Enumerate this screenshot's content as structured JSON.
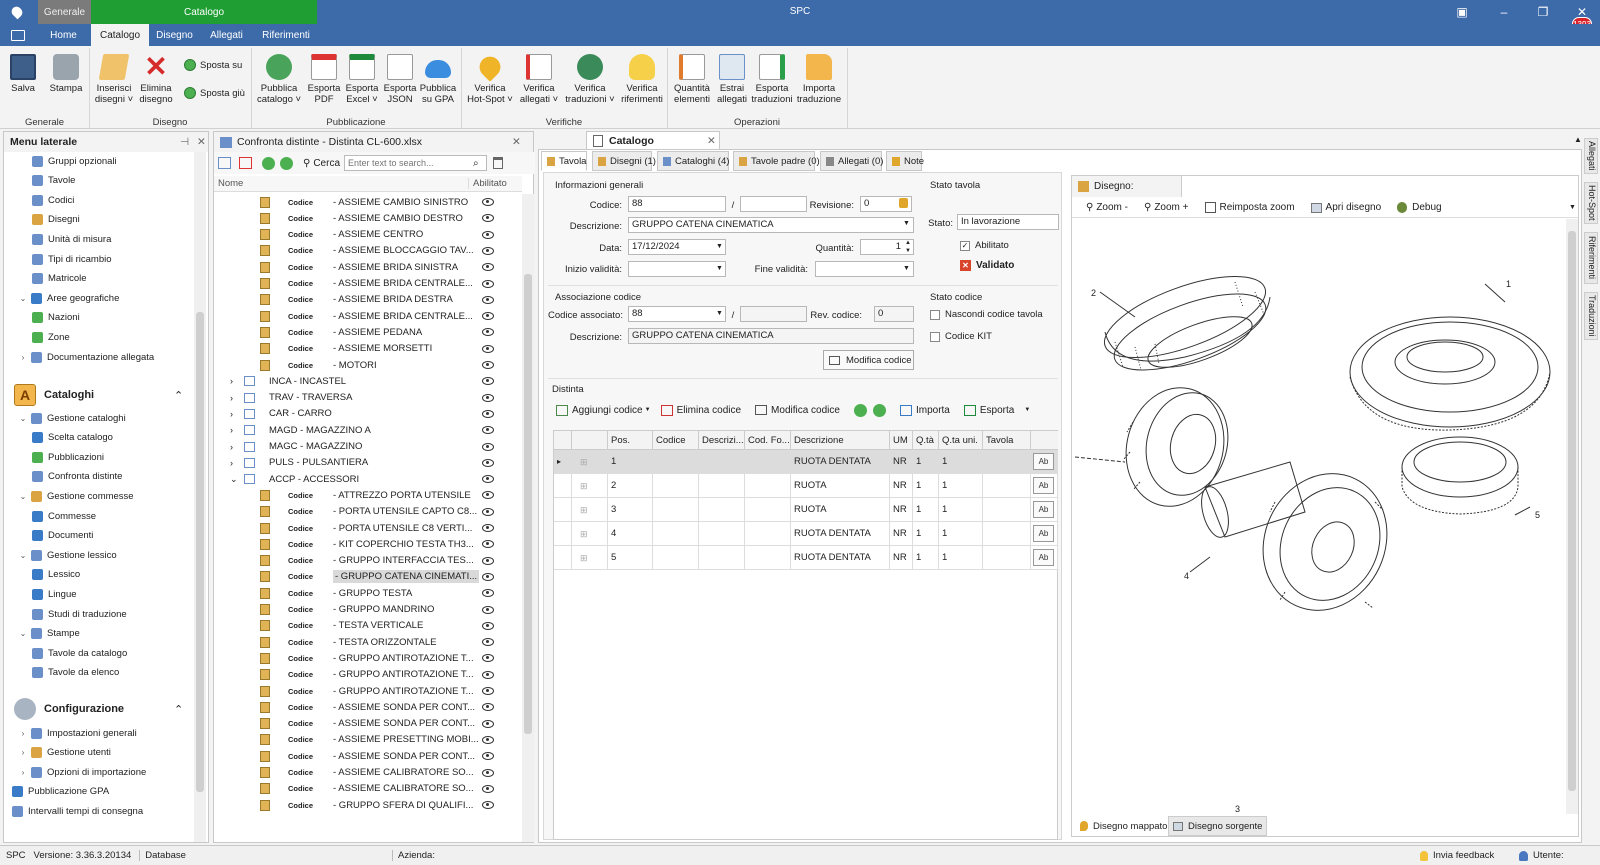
{
  "title_bar": {
    "app_title": "SPC",
    "context_general": "Generale",
    "context_catalog": "Catalogo",
    "notification_count": "1393"
  },
  "ribbon_tabs": [
    "Home",
    "Catalogo",
    "Disegno",
    "Allegati",
    "Riferimenti"
  ],
  "ribbon": {
    "buttons": {
      "salva": "Salva",
      "stampa": "Stampa",
      "inserisci": "Inserisci\ndisegni ˅",
      "elimina": "Elimina\ndisegno",
      "sposta_su": "Sposta su",
      "sposta_giu": "Sposta giù",
      "pubblica_catalogo": "Pubblica\ncatalogo ˅",
      "esporta_pdf": "Esporta\nPDF",
      "esporta_excel": "Esporta\nExcel ˅",
      "esporta_json": "Esporta\nJSON",
      "pubblica_gpa": "Pubblica\nsu GPA",
      "verifica_hotspot": "Verifica\nHot-Spot ˅",
      "verifica_allegati": "Verifica\nallegati ˅",
      "verifica_traduzioni": "Verifica\ntraduzioni ˅",
      "verifica_riferimenti": "Verifica\nriferimenti",
      "quantita_elementi": "Quantità\nelementi",
      "estrai_allegati": "Estrai\nallegati",
      "esporta_traduzioni": "Esporta\ntraduzioni",
      "importa_traduzione": "Importa\ntraduzione"
    },
    "groups": {
      "generale": "Generale",
      "disegno": "Disegno",
      "pubblicazione": "Pubblicazione",
      "verifiche": "Verifiche",
      "operazioni": "Operazioni"
    }
  },
  "left_panel": {
    "title": "Menu laterale",
    "items_top": [
      {
        "label": "Gruppi opzionali",
        "color": "#6b8fc9"
      },
      {
        "label": "Tavole",
        "color": "#6b8fc9"
      },
      {
        "label": "Codici",
        "color": "#6b8fc9"
      },
      {
        "label": "Disegni",
        "color": "#d9a441"
      },
      {
        "label": "Unità di misura",
        "color": "#6b8fc9"
      },
      {
        "label": "Tipi di ricambio",
        "color": "#6b8fc9"
      },
      {
        "label": "Matricole",
        "color": "#6b8fc9"
      },
      {
        "label": "Aree geografiche",
        "color": "#3a7bc8"
      },
      {
        "label": "Nazioni",
        "color": "#4caf50"
      },
      {
        "label": "Zone",
        "color": "#4caf50"
      },
      {
        "label": "Documentazione allegata",
        "color": "#6b8fc9"
      }
    ],
    "section_cataloghi": "Cataloghi",
    "items_cataloghi": [
      {
        "label": "Gestione cataloghi",
        "color": "#6b8fc9"
      },
      {
        "label": "Scelta catalogo",
        "color": "#3a7bc8"
      },
      {
        "label": "Pubblicazioni",
        "color": "#4caf50"
      },
      {
        "label": "Confronta distinte",
        "color": "#6b8fc9"
      },
      {
        "label": "Gestione commesse",
        "color": "#d9a441"
      },
      {
        "label": "Commesse",
        "color": "#3a7bc8"
      },
      {
        "label": "Documenti",
        "color": "#3a7bc8"
      },
      {
        "label": "Gestione lessico",
        "color": "#6b8fc9"
      },
      {
        "label": "Lessico",
        "color": "#3a7bc8"
      },
      {
        "label": "Lingue",
        "color": "#3a7bc8"
      },
      {
        "label": "Studi di traduzione",
        "color": "#6b8fc9"
      },
      {
        "label": "Stampe",
        "color": "#6b8fc9"
      },
      {
        "label": "Tavole da catalogo",
        "color": "#6b8fc9"
      },
      {
        "label": "Tavole da elenco",
        "color": "#6b8fc9"
      }
    ],
    "section_configurazione": "Configurazione",
    "items_config": [
      {
        "label": "Impostazioni generali",
        "color": "#6b8fc9"
      },
      {
        "label": "Gestione utenti",
        "color": "#d9a441"
      },
      {
        "label": "Opzioni di importazione",
        "color": "#6b8fc9"
      },
      {
        "label": "Pubblicazione GPA",
        "color": "#3a7bc8"
      },
      {
        "label": "Intervalli tempi di consegna",
        "color": "#6b8fc9"
      }
    ]
  },
  "middle_panel": {
    "title": "Confronta distinte - Distinta CL-600.xlsx",
    "search_label": "Cerca",
    "search_placeholder": "Enter text to search...",
    "col_name": "Nome",
    "col_enabled": "Abilitato",
    "codice_word": "Codice",
    "rows_a": [
      "- ASSIEME CAMBIO SINISTRO",
      "- ASSIEME CAMBIO DESTRO",
      "- ASSIEME CENTRO",
      "- ASSIEME BLOCCAGGIO TAV...",
      "- ASSIEME BRIDA SINISTRA",
      "- ASSIEME BRIDA CENTRALE...",
      "- ASSIEME BRIDA DESTRA",
      "- ASSIEME BRIDA CENTRALE...",
      "- ASSIEME PEDANA",
      "- ASSIEME MORSETTI",
      "- MOTORI"
    ],
    "groups": [
      "INCA - INCASTEL",
      "TRAV - TRAVERSA",
      "CAR - CARRO",
      "MAGD - MAGAZZINO A",
      "MAGC - MAGAZZINO",
      "PULS - PULSANTIERA",
      "ACCP - ACCESSORI"
    ],
    "rows_b": [
      "- ATTREZZO PORTA UTENSILE",
      "- PORTA UTENSILE CAPTO C8...",
      "- PORTA UTENSILE C8 VERTI...",
      "- KIT COPERCHIO TESTA TH3...",
      "- GRUPPO INTERFACCIA TES...",
      "- GRUPPO CATENA CINEMATI...",
      "- GRUPPO TESTA",
      "- GRUPPO MANDRINO",
      "- TESTA VERTICALE",
      "- TESTA ORIZZONTALE",
      "- GRUPPO ANTIROTAZIONE T...",
      "- GRUPPO ANTIROTAZIONE T...",
      "- GRUPPO ANTIROTAZIONE T...",
      "- ASSIEME SONDA PER CONT...",
      "- ASSIEME SONDA PER CONT...",
      "- ASSIEME PRESETTING MOBI...",
      "- ASSIEME SONDA PER CONT...",
      "- ASSIEME CALIBRATORE SO...",
      "- ASSIEME CALIBRATORE SO...",
      "- GRUPPO SFERA DI QUALIFI..."
    ]
  },
  "catalog_panel": {
    "title": "Catalogo",
    "tabs": [
      "Tavola",
      "Disegni (1)",
      "Cataloghi (4)",
      "Tavole padre (0)",
      "Allegati (0)",
      "Note"
    ],
    "info": {
      "group_title": "Informazioni generali",
      "codice_label": "Codice:",
      "codice_value": "88",
      "slash": "/",
      "revisione_label": "Revisione:",
      "revisione_value": "0",
      "descrizione_label": "Descrizione:",
      "descrizione_value": "GRUPPO CATENA CINEMATICA",
      "data_label": "Data:",
      "data_value": "17/12/2024",
      "quantita_label": "Quantità:",
      "quantita_value": "1",
      "inizio_label": "Inizio validità:",
      "fine_label": "Fine validità:"
    },
    "stato_tavola": {
      "group_title": "Stato tavola",
      "stato_label": "Stato:",
      "stato_value": "In lavorazione",
      "abilitato": "Abilitato",
      "validato": "Validato"
    },
    "associazione": {
      "group_title": "Associazione codice",
      "codice_label": "Codice associato:",
      "codice_value": "88",
      "slash": "/",
      "rev_label": "Rev. codice:",
      "rev_value": "0",
      "descrizione_label": "Descrizione:",
      "descrizione_value": "GRUPPO CATENA CINEMATICA",
      "modifica_button": "Modifica codice"
    },
    "stato_codice": {
      "group_title": "Stato codice",
      "nascondi": "Nascondi codice tavola",
      "kit": "Codice KIT"
    },
    "distinta": {
      "group_title": "Distinta",
      "aggiungi": "Aggiungi codice",
      "elimina": "Elimina codice",
      "modifica": "Modifica codice",
      "importa": "Importa",
      "esporta": "Esporta",
      "columns": [
        "Pos.",
        "Codice",
        "Descrizi...",
        "Cod. Fo...",
        "Descrizione",
        "UM",
        "Q.tà",
        "Q.ta uni.",
        "Tavola"
      ],
      "rows": [
        {
          "pos": "1",
          "descr": "RUOTA DENTATA",
          "um": "NR",
          "qta": "1",
          "qta_uni": "1"
        },
        {
          "pos": "2",
          "descr": "RUOTA",
          "um": "NR",
          "qta": "1",
          "qta_uni": "1"
        },
        {
          "pos": "3",
          "descr": "RUOTA",
          "um": "NR",
          "qta": "1",
          "qta_uni": "1"
        },
        {
          "pos": "4",
          "descr": "RUOTA DENTATA",
          "um": "NR",
          "qta": "1",
          "qta_uni": "1"
        },
        {
          "pos": "5",
          "descr": "RUOTA DENTATA",
          "um": "NR",
          "qta": "1",
          "qta_uni": "1"
        }
      ]
    }
  },
  "drawing_panel": {
    "title": "Disegno:",
    "toolbar": [
      "Zoom -",
      "Zoom +",
      "Reimposta zoom",
      "Apri disegno",
      "Debug"
    ],
    "callouts": [
      "1",
      "2",
      "3",
      "4",
      "5"
    ],
    "bottom_tabs": [
      "Disegno mappato",
      "Disegno sorgente"
    ]
  },
  "side_tabs": [
    "Allegati",
    "Hot-Spot",
    "Riferimenti",
    "Traduzioni"
  ],
  "status_bar": {
    "app": "SPC",
    "version": "Versione: 3.36.3.20134",
    "database": "Database",
    "azienda": "Azienda:",
    "feedback": "Invia feedback",
    "utente": "Utente:"
  },
  "colors": {
    "title_blue": "#3d6aa8",
    "context_green": "#1f9e34",
    "context_gray": "#7b7b7b",
    "badge_red": "#d9232b",
    "validated_red": "#d9452b"
  }
}
